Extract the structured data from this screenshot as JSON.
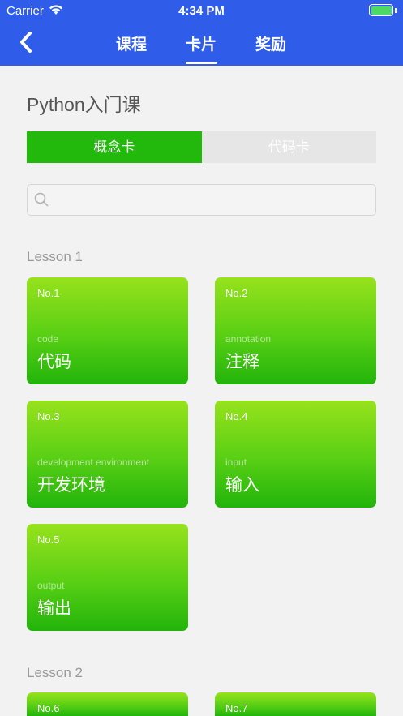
{
  "status_bar": {
    "carrier": "Carrier",
    "time": "4:34 PM"
  },
  "nav": {
    "tabs": [
      "课程",
      "卡片",
      "奖励"
    ],
    "active_tab": "卡片"
  },
  "course_title": "Python入门课",
  "segments": [
    "概念卡",
    "代码卡"
  ],
  "search": {
    "placeholder": "",
    "value": ""
  },
  "lessons": [
    {
      "label": "Lesson 1",
      "cards": [
        {
          "no": "No.1",
          "sub": "code",
          "title": "代码"
        },
        {
          "no": "No.2",
          "sub": "annotation",
          "title": "注释"
        },
        {
          "no": "No.3",
          "sub": "development environment",
          "title": "开发环境"
        },
        {
          "no": "No.4",
          "sub": "input",
          "title": "输入"
        },
        {
          "no": "No.5",
          "sub": "output",
          "title": "输出"
        }
      ]
    },
    {
      "label": "Lesson 2",
      "cards": [
        {
          "no": "No.6"
        },
        {
          "no": "No.7"
        }
      ]
    }
  ],
  "colors": {
    "header": "#2f5de9",
    "accent_green": "#22b90c",
    "segment_inactive": "#e6e6e6"
  }
}
